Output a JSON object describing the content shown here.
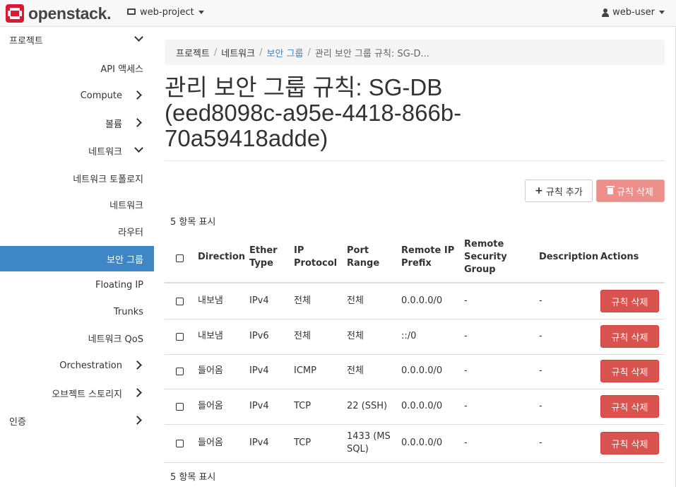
{
  "app": {
    "logo_text": "openstack."
  },
  "topbar": {
    "project": "web-project",
    "user": "web-user"
  },
  "sidebar": {
    "items": [
      {
        "label": "프로젝트"
      },
      {
        "label": "API 액세스"
      },
      {
        "label": "Compute"
      },
      {
        "label": "볼륨"
      },
      {
        "label": "네트워크"
      },
      {
        "label": "네트워크 토폴로지"
      },
      {
        "label": "네트워크"
      },
      {
        "label": "라우터"
      },
      {
        "label": "보안 그룹"
      },
      {
        "label": "Floating IP"
      },
      {
        "label": "Trunks"
      },
      {
        "label": "네트워크 QoS"
      },
      {
        "label": "Orchestration"
      },
      {
        "label": "오브젝트 스토리지"
      },
      {
        "label": "인증"
      }
    ]
  },
  "breadcrumb": [
    "프로젝트",
    "네트워크",
    "보안 그룹",
    "관리 보안 그룹 규칙: SG-D..."
  ],
  "page": {
    "title": "관리 보안 그룹 규칙: SG-DB (eed8098c-a95e-4418-866b-70a59418adde)"
  },
  "actions": {
    "add_rule": "규칙 추가",
    "delete_rules": "규칙 삭제"
  },
  "table": {
    "count_text": "5 항목 표시",
    "columns": [
      "Direction",
      "Ether Type",
      "IP Protocol",
      "Port Range",
      "Remote IP Prefix",
      "Remote Security Group",
      "Description",
      "Actions"
    ],
    "rows": [
      {
        "direction": "내보냄",
        "ether_type": "IPv4",
        "ip_protocol": "전체",
        "port_range": "전체",
        "remote_ip_prefix": "0.0.0.0/0",
        "remote_sg": "-",
        "description": "-",
        "action": "규칙 삭제"
      },
      {
        "direction": "내보냄",
        "ether_type": "IPv6",
        "ip_protocol": "전체",
        "port_range": "전체",
        "remote_ip_prefix": "::/0",
        "remote_sg": "-",
        "description": "-",
        "action": "규칙 삭제"
      },
      {
        "direction": "들어옴",
        "ether_type": "IPv4",
        "ip_protocol": "ICMP",
        "port_range": "전체",
        "remote_ip_prefix": "0.0.0.0/0",
        "remote_sg": "-",
        "description": "-",
        "action": "규칙 삭제"
      },
      {
        "direction": "들어옴",
        "ether_type": "IPv4",
        "ip_protocol": "TCP",
        "port_range": "22 (SSH)",
        "remote_ip_prefix": "0.0.0.0/0",
        "remote_sg": "-",
        "description": "-",
        "action": "규칙 삭제"
      },
      {
        "direction": "들어옴",
        "ether_type": "IPv4",
        "ip_protocol": "TCP",
        "port_range": "1433 (MS SQL)",
        "remote_ip_prefix": "0.0.0.0/0",
        "remote_sg": "-",
        "description": "-",
        "action": "규칙 삭제"
      }
    ]
  },
  "colors": {
    "accent": "#3f86c6",
    "danger": "#d9534f",
    "danger_disabled": "#ee8f8b",
    "logo_red": "#da1a32"
  }
}
